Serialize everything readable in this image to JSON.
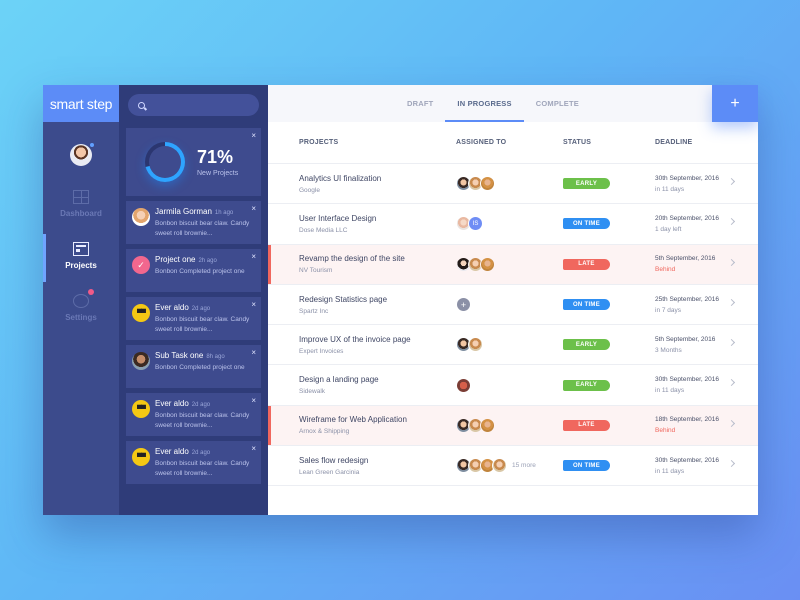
{
  "app": {
    "logo": "smart step"
  },
  "rail": {
    "items": [
      {
        "label": "Dashboard"
      },
      {
        "label": "Projects"
      },
      {
        "label": "Settings"
      }
    ]
  },
  "feed": {
    "search_placeholder": "",
    "stat": {
      "percent": "71%",
      "label": "New Projects",
      "value": 0.71
    },
    "close": "×",
    "notifications": [
      {
        "name": "Jarmila Gorman",
        "time": "1h ago",
        "text": "Bonbon biscuit bear claw. Candy sweet roll brownie..."
      },
      {
        "name": "Project one",
        "time": "2h ago",
        "text": "Bonbon Completed project one"
      },
      {
        "name": "Ever aldo",
        "time": "2d ago",
        "text": "Bonbon biscuit bear claw. Candy sweet roll brownie..."
      },
      {
        "name": "Sub Task one",
        "time": "8h ago",
        "text": "Bonbon Completed project one"
      },
      {
        "name": "Ever aldo",
        "time": "2d ago",
        "text": "Bonbon biscuit bear claw. Candy sweet roll brownie..."
      },
      {
        "name": "Ever aldo",
        "time": "2d ago",
        "text": "Bonbon biscuit bear claw. Candy sweet roll brownie..."
      }
    ]
  },
  "tabs": [
    {
      "label": "DRAFT"
    },
    {
      "label": "IN PROGRESS"
    },
    {
      "label": "COMPLETE"
    }
  ],
  "add_button": "+",
  "table": {
    "headers": {
      "projects": "PROJECTS",
      "assigned": "ASSIGNED TO",
      "status": "STATUS",
      "deadline": "DEADLINE"
    },
    "rows": [
      {
        "name": "Analytics UI finalization",
        "client": "Google",
        "status": "EARLY",
        "date": "30th September, 2016",
        "note": "in 11 days",
        "more": ""
      },
      {
        "name": "User Interface Design",
        "client": "Dose Media LLC",
        "status": "ON TIME",
        "date": "20th September, 2016",
        "note": "1 day left",
        "more": ""
      },
      {
        "name": "Revamp the design of the site",
        "client": "NV Tourism",
        "status": "LATE",
        "date": "5th September, 2016",
        "note": "Behind",
        "more": ""
      },
      {
        "name": "Redesign Statistics page",
        "client": "Spartz Inc",
        "status": "ON TIME",
        "date": "25th September, 2016",
        "note": "in 7 days",
        "more": ""
      },
      {
        "name": "Improve UX of the invoice page",
        "client": "Expert Invoices",
        "status": "EARLY",
        "date": "5th September, 2016",
        "note": "3 Months",
        "more": ""
      },
      {
        "name": "Design a landing page",
        "client": "Sidewalk",
        "status": "EARLY",
        "date": "30th September, 2016",
        "note": "in 11 days",
        "more": ""
      },
      {
        "name": "Wireframe for Web Application",
        "client": "Arnox & Shipping",
        "status": "LATE",
        "date": "18th September, 2016",
        "note": "Behind",
        "more": ""
      },
      {
        "name": "Sales flow redesign",
        "client": "Lean Green Garcinia",
        "status": "ON TIME",
        "date": "30th September, 2016",
        "note": "in 11 days",
        "more": "15 more"
      }
    ]
  },
  "assignee_initials": {
    "row2": "IS"
  },
  "colors": {
    "accent": "#5c8cf7",
    "early": "#6cc04a",
    "on_time": "#2f8ff2",
    "late": "#f0675e",
    "rail": "#3c4b8c",
    "feed": "#2f3c79"
  }
}
